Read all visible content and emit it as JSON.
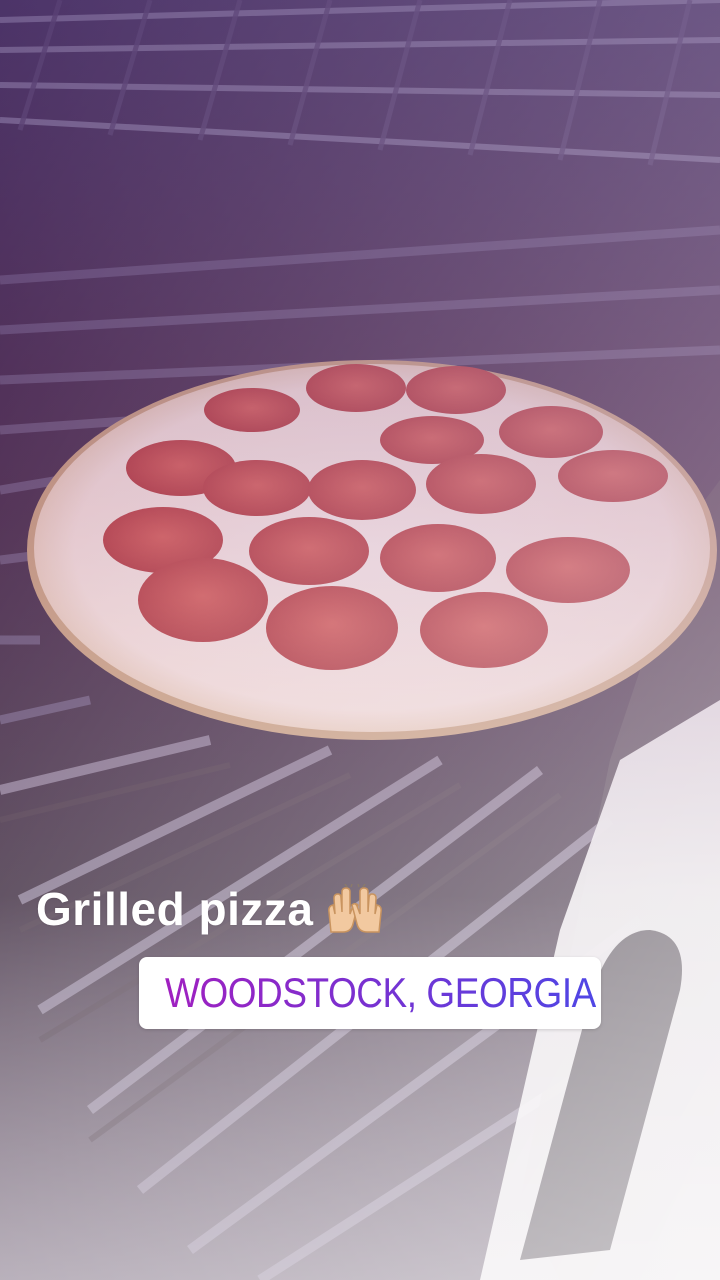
{
  "story": {
    "caption": "Grilled pizza",
    "caption_emoji": "raised-hands-emoji",
    "location": "WOODSTOCK, GEORGIA",
    "location_icon": "location-pin-icon",
    "colors": {
      "caption_text": "#ffffff",
      "location_gradient_start": "#a020c0",
      "location_gradient_end": "#4f46e5",
      "sticker_background": "#ffffff"
    }
  }
}
